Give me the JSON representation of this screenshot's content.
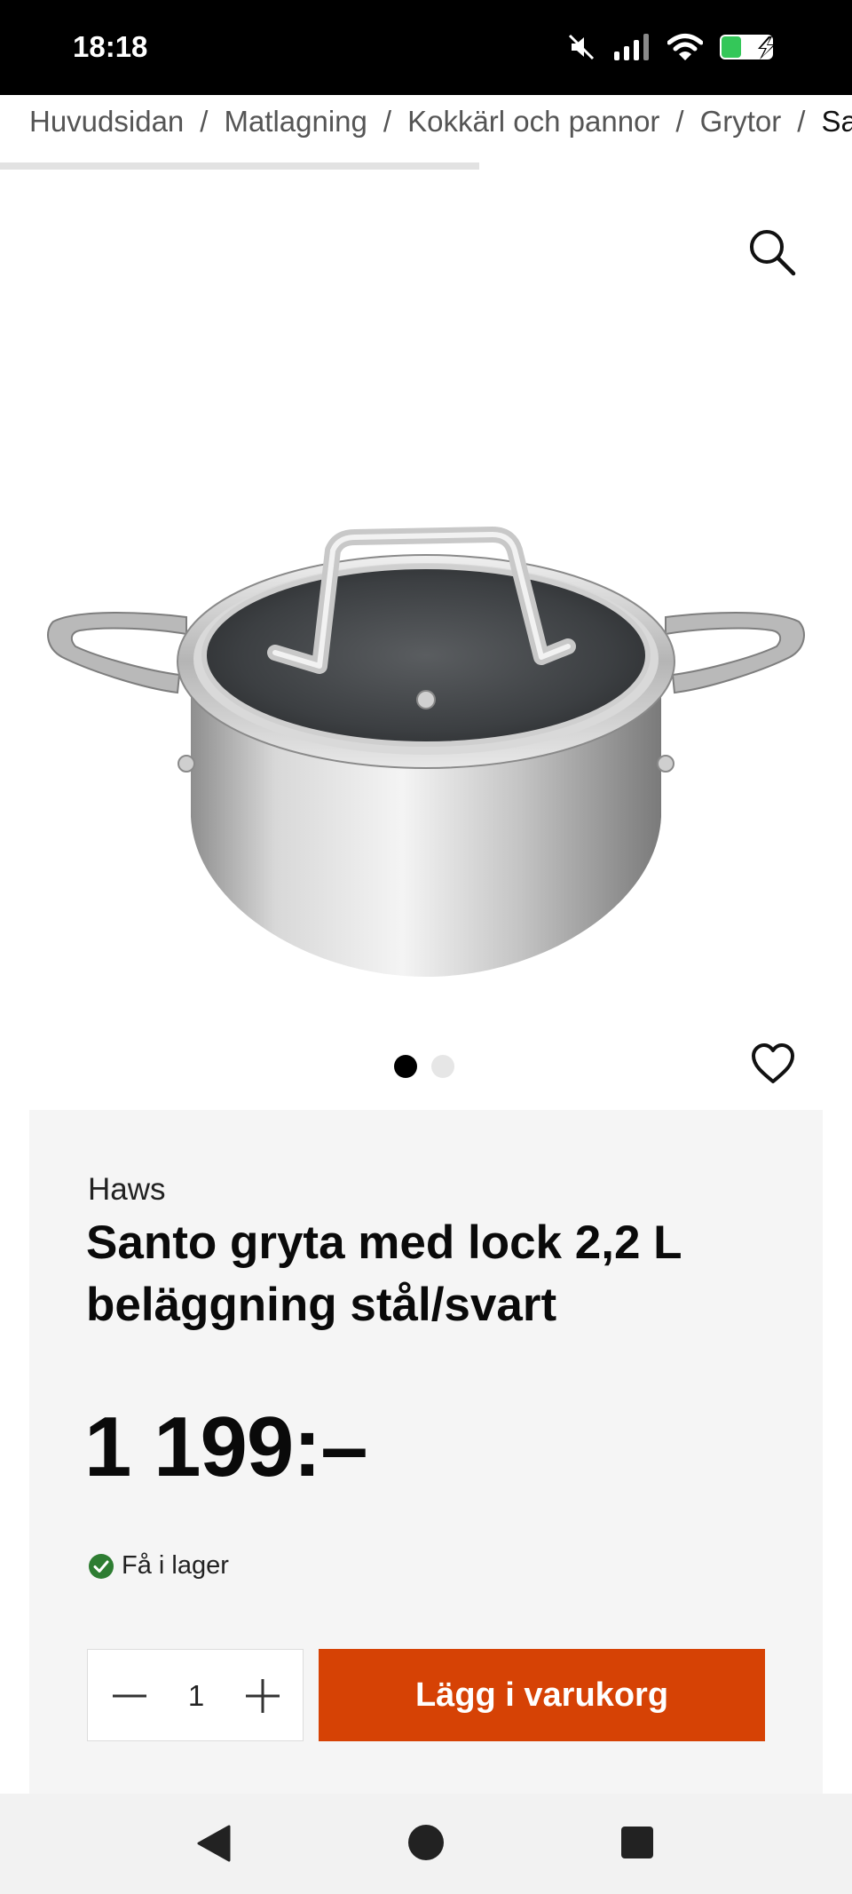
{
  "status_bar": {
    "time": "18:18",
    "icons": [
      "mute-icon",
      "signal-icon",
      "wifi-icon",
      "battery-charging-icon"
    ]
  },
  "breadcrumb": {
    "items": [
      "Huvudsidan",
      "Matlagning",
      "Kokkärl och pannor",
      "Grytor",
      "Sa"
    ],
    "separator": "/"
  },
  "gallery": {
    "image_alt": "Santo gryta med lock",
    "image_count": 2,
    "active_index": 0,
    "zoom_icon": "search-icon",
    "wishlist_icon": "heart-icon"
  },
  "product": {
    "brand": "Haws",
    "title": "Santo gryta med lock 2,2 L beläggning stål/svart",
    "price": "1 199:–",
    "stock_text": "Få i lager",
    "stock_color": "#2e7d32"
  },
  "purchase": {
    "quantity": "1",
    "add_to_cart_label": "Lägg i varukorg",
    "accent_color": "#d64205"
  },
  "nav_bar": {
    "icons": [
      "back-icon",
      "home-icon",
      "recents-icon"
    ]
  }
}
